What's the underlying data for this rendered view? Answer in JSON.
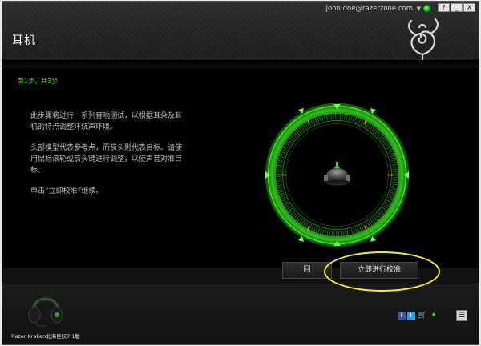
{
  "header": {
    "user_email": "john.doe@razerzone.com",
    "title": "耳机",
    "window_buttons": {
      "help": "?",
      "minimize": "_",
      "close": "X"
    }
  },
  "main": {
    "step": "第1步，共3步",
    "instructions": [
      "此步骤将进行一系列音响测试，以根据耳朵及耳机的特点调整环绕声环境。",
      "头部模型代表参考点，而箭头则代表目标。请使用鼠标滚轮或箭头键进行调整，以使声音对准目标。",
      "单击“立即校准”继续。"
    ],
    "back_label": "回",
    "calibrate_label": "立即进行校准"
  },
  "footer": {
    "device_name": "Razer Kraken北海巨妖7.1版",
    "menu_label": "☰"
  },
  "colors": {
    "accent": "#44d62c",
    "highlight": "#f5e93a",
    "background": "#000000"
  },
  "icons": [
    "razer-logo-icon",
    "status-dot-icon",
    "facebook-icon",
    "twitter-icon",
    "cart-icon",
    "razer-small-icon",
    "menu-icon"
  ]
}
